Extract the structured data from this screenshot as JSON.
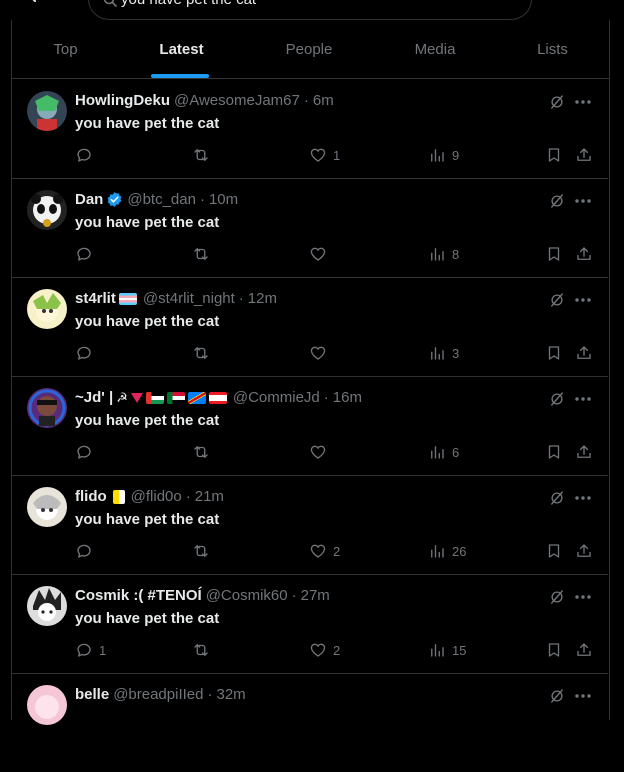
{
  "search": {
    "query": "you have pet the cat"
  },
  "tabs": [
    {
      "label": "Top"
    },
    {
      "label": "Latest"
    },
    {
      "label": "People"
    },
    {
      "label": "Media"
    },
    {
      "label": "Lists"
    }
  ],
  "active_tab": "Latest",
  "colors": {
    "accent": "#1d9bf0",
    "verified": "#1d9bf0",
    "border": "#2f3336",
    "muted": "#71767b"
  },
  "tweets": [
    {
      "name": "HowlingDeku",
      "handle": "@AwesomeJam67",
      "time": "6m",
      "text": "you have pet the cat",
      "replies": "",
      "reposts": "",
      "likes": "1",
      "views": "9"
    },
    {
      "name": "Dan",
      "handle": "@btc_dan",
      "time": "10m",
      "text": "you have pet the cat",
      "replies": "",
      "reposts": "",
      "likes": "",
      "views": "8",
      "badge": "verified-badge-icon"
    },
    {
      "name": "st4rlit",
      "handle": "@st4rlit_night",
      "time": "12m",
      "text": "you have pet the cat",
      "replies": "",
      "reposts": "",
      "likes": "",
      "views": "3",
      "badge": "trans-flag-icon"
    },
    {
      "name": "~Jd' | ",
      "handle": "@CommieJd",
      "time": "16m",
      "text": "you have pet the cat",
      "replies": "",
      "reposts": "",
      "likes": "",
      "views": "6",
      "badge": "flags-icons"
    },
    {
      "name": "flido",
      "handle": "@flid0o",
      "time": "21m",
      "text": "you have pet the cat",
      "replies": "",
      "reposts": "",
      "likes": "2",
      "views": "26",
      "badge": "vatican-flag-icon"
    },
    {
      "name": "Cosmik :( #TENOÍ",
      "handle": "@Cosmik60",
      "time": "27m",
      "text": "you have pet the cat",
      "replies": "1",
      "reposts": "",
      "likes": "2",
      "views": "15"
    },
    {
      "name": "belle",
      "handle": "@breadpiIIed",
      "time": "32m",
      "text": "",
      "replies": "",
      "reposts": "",
      "likes": "",
      "views": ""
    }
  ]
}
